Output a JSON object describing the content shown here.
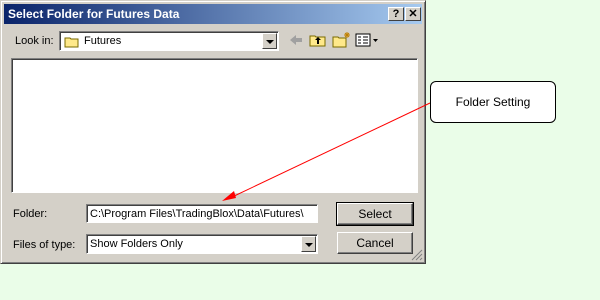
{
  "window": {
    "title": "Select Folder for Futures Data",
    "help_button": "?",
    "close_button": "✕"
  },
  "look_in": {
    "label": "Look in:",
    "value": "Futures"
  },
  "folder": {
    "label": "Folder:",
    "value": "C:\\Program Files\\TradingBlox\\Data\\Futures\\"
  },
  "files_of_type": {
    "label": "Files of type:",
    "value": "Show Folders Only"
  },
  "buttons": {
    "select": "Select",
    "cancel": "Cancel"
  },
  "callout": {
    "text": "Folder Setting",
    "arrow_color": "#ff0000"
  },
  "colors": {
    "background": "#eafde8",
    "dialog_face": "#d4d0c8",
    "title_start": "#0a246a",
    "title_end": "#a6caf0"
  }
}
